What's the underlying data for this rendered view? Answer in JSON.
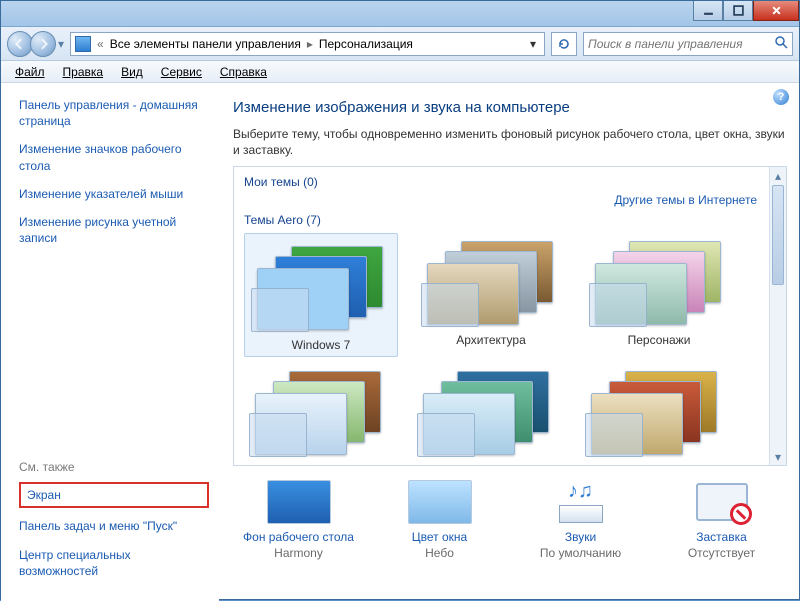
{
  "titlebar": {},
  "toolbar": {
    "breadcrumb_prefix": "«",
    "crumb1": "Все элементы панели управления",
    "crumb2": "Персонализация",
    "search_placeholder": "Поиск в панели управления"
  },
  "menubar": {
    "file": "Файл",
    "edit": "Правка",
    "view": "Вид",
    "tools": "Сервис",
    "help": "Справка"
  },
  "sidebar": {
    "home": "Панель управления - домашняя страница",
    "link1": "Изменение значков рабочего стола",
    "link2": "Изменение указателей мыши",
    "link3": "Изменение рисунка учетной записи",
    "seealso_hdr": "См. также",
    "seealso1": "Экран",
    "seealso2": "Панель задач и меню \"Пуск\"",
    "seealso3": "Центр специальных возможностей"
  },
  "main": {
    "heading": "Изменение изображения и звука на компьютере",
    "desc": "Выберите тему, чтобы одновременно изменить фоновый рисунок рабочего стола, цвет окна, звуки и заставку.",
    "my_themes_hdr": "Мои темы (0)",
    "internet_link": "Другие темы в Интернете",
    "aero_hdr": "Темы Aero (7)",
    "themes": {
      "t1": "Windows 7",
      "t2": "Архитектура",
      "t3": "Персонажи"
    },
    "options": {
      "bg_title": "Фон рабочего стола",
      "bg_sub": "Harmony",
      "color_title": "Цвет окна",
      "color_sub": "Небо",
      "sound_title": "Звуки",
      "sound_sub": "По умолчанию",
      "saver_title": "Заставка",
      "saver_sub": "Отсутствует"
    }
  }
}
